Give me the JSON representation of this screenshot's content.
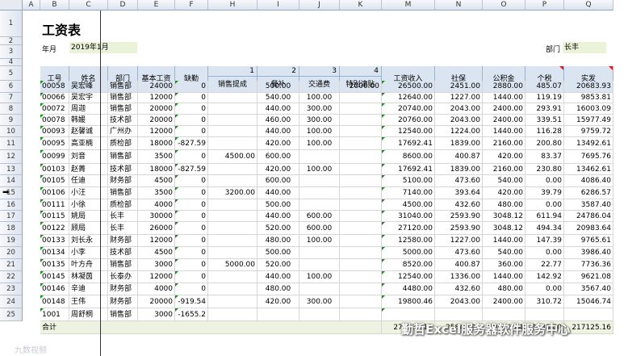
{
  "columns": [
    "A",
    "B",
    "C",
    "D",
    "E",
    "F",
    "H",
    "I",
    "J",
    "K",
    "M",
    "N",
    "O",
    "P",
    "Q"
  ],
  "rows": [
    "1",
    "2",
    "3",
    "4",
    "5",
    "6",
    "7",
    "8",
    "9",
    "10",
    "11",
    "12",
    "13",
    "14",
    "15",
    "16",
    "17",
    "18",
    "19",
    "20",
    "21",
    "22",
    "23",
    "24",
    "25"
  ],
  "sheet_title": "工资表",
  "month_label": "年月",
  "month_value": "2019年1月",
  "dept_label": "部门",
  "dept_value": "长丰",
  "header": {
    "id": "工号",
    "name": "姓名",
    "dept": "部门",
    "base": "基本工资",
    "absence": "缺勤",
    "n1": "1",
    "n2": "2",
    "n3": "3",
    "n4": "4",
    "sales_bonus": "销售提成",
    "meal": "餐补",
    "transport": "交通费",
    "special": "特别津贴",
    "income": "工资收入",
    "social": "社保",
    "fund": "公积金",
    "tax": "个税",
    "net": "实发"
  },
  "table_rows": [
    {
      "id": "00058",
      "name": "吴宏峰",
      "dept": "销售部",
      "base": "24000",
      "absence": "0",
      "sales": "",
      "meal": "500.00",
      "transport": "",
      "special": "2000.00",
      "income": "26500.00",
      "social": "2451.00",
      "fund": "2880.00",
      "tax": "485.07",
      "net": "20683.93"
    },
    {
      "id": "00066",
      "name": "吴宏宇",
      "dept": "销售部",
      "base": "12000",
      "absence": "0",
      "sales": "",
      "meal": "540.00",
      "transport": "100.00",
      "special": "",
      "income": "12640.00",
      "social": "1227.00",
      "fund": "1440.00",
      "tax": "119.19",
      "net": "9853.81"
    },
    {
      "id": "00072",
      "name": "周迦",
      "dept": "销售部",
      "base": "20000",
      "absence": "0",
      "sales": "",
      "meal": "440.00",
      "transport": "300.00",
      "special": "",
      "income": "20740.00",
      "social": "2043.00",
      "fund": "2400.00",
      "tax": "293.91",
      "net": "16003.09"
    },
    {
      "id": "00078",
      "name": "韩媛",
      "dept": "技术部",
      "base": "20000",
      "absence": "0",
      "sales": "",
      "meal": "460.00",
      "transport": "300.00",
      "special": "",
      "income": "20760.00",
      "social": "2043.00",
      "fund": "2400.00",
      "tax": "339.51",
      "net": "15977.49"
    },
    {
      "id": "00093",
      "name": "赵馨诚",
      "dept": "广州办",
      "base": "12000",
      "absence": "0",
      "sales": "",
      "meal": "440.00",
      "transport": "100.00",
      "special": "",
      "income": "12540.00",
      "social": "1224.00",
      "fund": "1440.00",
      "tax": "116.28",
      "net": "9759.72"
    },
    {
      "id": "00095",
      "name": "高亚楠",
      "dept": "质检部",
      "base": "18000",
      "absence": "-827.59",
      "sales": "",
      "meal": "420.00",
      "transport": "100.00",
      "special": "",
      "income": "17692.41",
      "social": "1839.00",
      "fund": "2160.00",
      "tax": "200.80",
      "net": "13492.61"
    },
    {
      "id": "00099",
      "name": "刘音",
      "dept": "销售部",
      "base": "3500",
      "absence": "0",
      "sales": "4500.00",
      "meal": "600.00",
      "transport": "",
      "special": "",
      "income": "8600.00",
      "social": "400.87",
      "fund": "420.00",
      "tax": "83.37",
      "net": "7695.76"
    },
    {
      "id": "00103",
      "name": "赵菁",
      "dept": "技术部",
      "base": "18000",
      "absence": "-827.59",
      "sales": "",
      "meal": "420.00",
      "transport": "100.00",
      "special": "",
      "income": "17692.41",
      "social": "1839.00",
      "fund": "2160.00",
      "tax": "230.80",
      "net": "13462.61"
    },
    {
      "id": "00105",
      "name": "任迪",
      "dept": "财务部",
      "base": "4500",
      "absence": "0",
      "sales": "",
      "meal": "600.00",
      "transport": "",
      "special": "",
      "income": "5100.00",
      "social": "473.60",
      "fund": "540.00",
      "tax": "0.00",
      "net": "4086.40"
    },
    {
      "id": "00106",
      "name": "小汪",
      "dept": "销售部",
      "base": "3500",
      "absence": "0",
      "sales": "3200.00",
      "meal": "440.00",
      "transport": "",
      "special": "",
      "income": "7140.00",
      "social": "393.64",
      "fund": "420.00",
      "tax": "39.79",
      "net": "6286.57"
    },
    {
      "id": "00111",
      "name": "小徐",
      "dept": "质检部",
      "base": "4000",
      "absence": "0",
      "sales": "",
      "meal": "500.00",
      "transport": "",
      "special": "",
      "income": "4500.00",
      "social": "432.60",
      "fund": "480.00",
      "tax": "0.00",
      "net": "3587.40"
    },
    {
      "id": "00115",
      "name": "姚局",
      "dept": "长丰",
      "base": "30000",
      "absence": "0",
      "sales": "",
      "meal": "440.00",
      "transport": "600.00",
      "special": "",
      "income": "31040.00",
      "social": "2593.90",
      "fund": "3048.12",
      "tax": "611.94",
      "net": "24786.04"
    },
    {
      "id": "00122",
      "name": "顾局",
      "dept": "长丰",
      "base": "26000",
      "absence": "0",
      "sales": "",
      "meal": "520.00",
      "transport": "600.00",
      "special": "",
      "income": "27120.00",
      "social": "2593.90",
      "fund": "3048.12",
      "tax": "494.34",
      "net": "20983.64"
    },
    {
      "id": "00133",
      "name": "刘长永",
      "dept": "财务部",
      "base": "12000",
      "absence": "0",
      "sales": "",
      "meal": "480.00",
      "transport": "100.00",
      "special": "",
      "income": "12580.00",
      "social": "1227.00",
      "fund": "1440.00",
      "tax": "147.39",
      "net": "9765.61"
    },
    {
      "id": "00134",
      "name": "小李",
      "dept": "技术部",
      "base": "4500",
      "absence": "0",
      "sales": "",
      "meal": "500.00",
      "transport": "",
      "special": "",
      "income": "5000.00",
      "social": "473.60",
      "fund": "540.00",
      "tax": "0.00",
      "net": "3986.40"
    },
    {
      "id": "00135",
      "name": "叶方舟",
      "dept": "销售部",
      "base": "3000",
      "absence": "0",
      "sales": "5000.00",
      "meal": "520.00",
      "transport": "",
      "special": "",
      "income": "8520.00",
      "social": "400.87",
      "fund": "360.00",
      "tax": "22.77",
      "net": "7736.36"
    },
    {
      "id": "00145",
      "name": "林凝茵",
      "dept": "长泰办",
      "base": "12000",
      "absence": "0",
      "sales": "",
      "meal": "440.00",
      "transport": "100.00",
      "special": "",
      "income": "12540.00",
      "social": "1336.00",
      "fund": "1440.00",
      "tax": "142.92",
      "net": "9621.08"
    },
    {
      "id": "00146",
      "name": "辛迪",
      "dept": "财务部",
      "base": "4000",
      "absence": "0",
      "sales": "",
      "meal": "480.00",
      "transport": "",
      "special": "",
      "income": "4480.00",
      "social": "432.60",
      "fund": "480.00",
      "tax": "0.00",
      "net": "3567.40"
    },
    {
      "id": "00148",
      "name": "王伟",
      "dept": "财务部",
      "base": "20000",
      "absence": "-919.54",
      "sales": "",
      "meal": "420.00",
      "transport": "300.00",
      "special": "",
      "income": "19800.46",
      "social": "2043.00",
      "fund": "2400.00",
      "tax": "310.72",
      "net": "15046.74"
    },
    {
      "id": "1001",
      "name": "周舒桐",
      "dept": "销售部",
      "base": "3000",
      "absence": "-1655.2",
      "sales": "",
      "meal": "",
      "transport": "",
      "special": "",
      "income": "",
      "social": "",
      "fund": "",
      "tax": "",
      "net": ""
    }
  ],
  "total_row": {
    "label": "合计",
    "income": "276530.11",
    "social": "25849.91",
    "fund": "29916.24",
    "tax": "3638.80",
    "net": "217125.16"
  },
  "watermark_text": "勤哲Excel服务器软件服务中心",
  "watermark_left": "九数视频"
}
